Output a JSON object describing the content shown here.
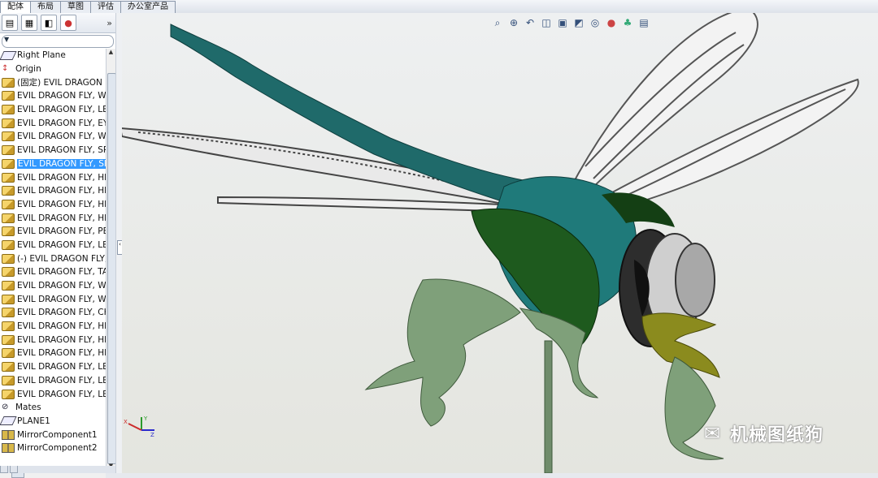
{
  "command_tabs": [
    "配体",
    "布局",
    "草图",
    "评估",
    "办公室产品"
  ],
  "feature_manager": {
    "toolbar_icons": [
      "feature-tree-icon",
      "property-manager-icon",
      "configuration-manager-icon",
      "display-manager-icon"
    ],
    "expand_glyph": "»",
    "tree": [
      {
        "label": "Right Plane",
        "icon": "plane"
      },
      {
        "label": "Origin",
        "icon": "origin"
      },
      {
        "label": "(固定) EVIL DRAGON F",
        "icon": "part"
      },
      {
        "label": "EVIL DRAGON FLY, WI",
        "icon": "part"
      },
      {
        "label": "EVIL DRAGON FLY, LEC",
        "icon": "part"
      },
      {
        "label": "EVIL DRAGON FLY, EYE",
        "icon": "part"
      },
      {
        "label": "EVIL DRAGON FLY, WI",
        "icon": "part"
      },
      {
        "label": "EVIL DRAGON FLY, SPI",
        "icon": "part"
      },
      {
        "label": "EVIL DRAGON FLY, SPI",
        "icon": "part",
        "selected": true
      },
      {
        "label": "EVIL DRAGON FLY, HE.",
        "icon": "part"
      },
      {
        "label": "EVIL DRAGON FLY, HE.",
        "icon": "part"
      },
      {
        "label": "EVIL DRAGON FLY, HE",
        "icon": "part"
      },
      {
        "label": "EVIL DRAGON FLY, HE",
        "icon": "part"
      },
      {
        "label": "EVIL DRAGON FLY, PEI",
        "icon": "part"
      },
      {
        "label": "EVIL DRAGON FLY, LEC",
        "icon": "part"
      },
      {
        "label": "(-) EVIL DRAGON FLY,",
        "icon": "part"
      },
      {
        "label": "EVIL DRAGON FLY, TAI",
        "icon": "part"
      },
      {
        "label": "EVIL DRAGON FLY, WI",
        "icon": "part"
      },
      {
        "label": "EVIL DRAGON FLY, WI",
        "icon": "part"
      },
      {
        "label": "EVIL DRAGON FLY, CH",
        "icon": "part"
      },
      {
        "label": "EVIL DRAGON FLY, HE.",
        "icon": "part"
      },
      {
        "label": "EVIL DRAGON FLY, HE.",
        "icon": "part"
      },
      {
        "label": "EVIL DRAGON FLY, HE.",
        "icon": "part"
      },
      {
        "label": "EVIL DRAGON FLY, LEC",
        "icon": "part"
      },
      {
        "label": "EVIL DRAGON FLY, LEC",
        "icon": "part"
      },
      {
        "label": "EVIL DRAGON FLY, LEC",
        "icon": "part"
      },
      {
        "label": "Mates",
        "icon": "mates"
      },
      {
        "label": "PLANE1",
        "icon": "plane"
      },
      {
        "label": "MirrorComponent1",
        "icon": "mirror"
      },
      {
        "label": "MirrorComponent2",
        "icon": "mirror"
      }
    ]
  },
  "heads_up_toolbar": [
    "zoom-to-fit-icon",
    "zoom-to-area-icon",
    "previous-view-icon",
    "section-view-icon",
    "view-orientation-icon",
    "display-style-icon",
    "hide-show-items-icon",
    "edit-appearance-icon",
    "apply-scene-icon",
    "view-settings-icon"
  ],
  "colors": {
    "selection": "#3399ff",
    "wing_outline": "#555555",
    "body_teal": "#1f6a6a",
    "body_green": "#1e5a1e",
    "leg_green": "#7fa07a",
    "olive": "#8b8b1e"
  },
  "watermark": {
    "text": "机械图纸狗",
    "icon": "wechat-icon"
  }
}
